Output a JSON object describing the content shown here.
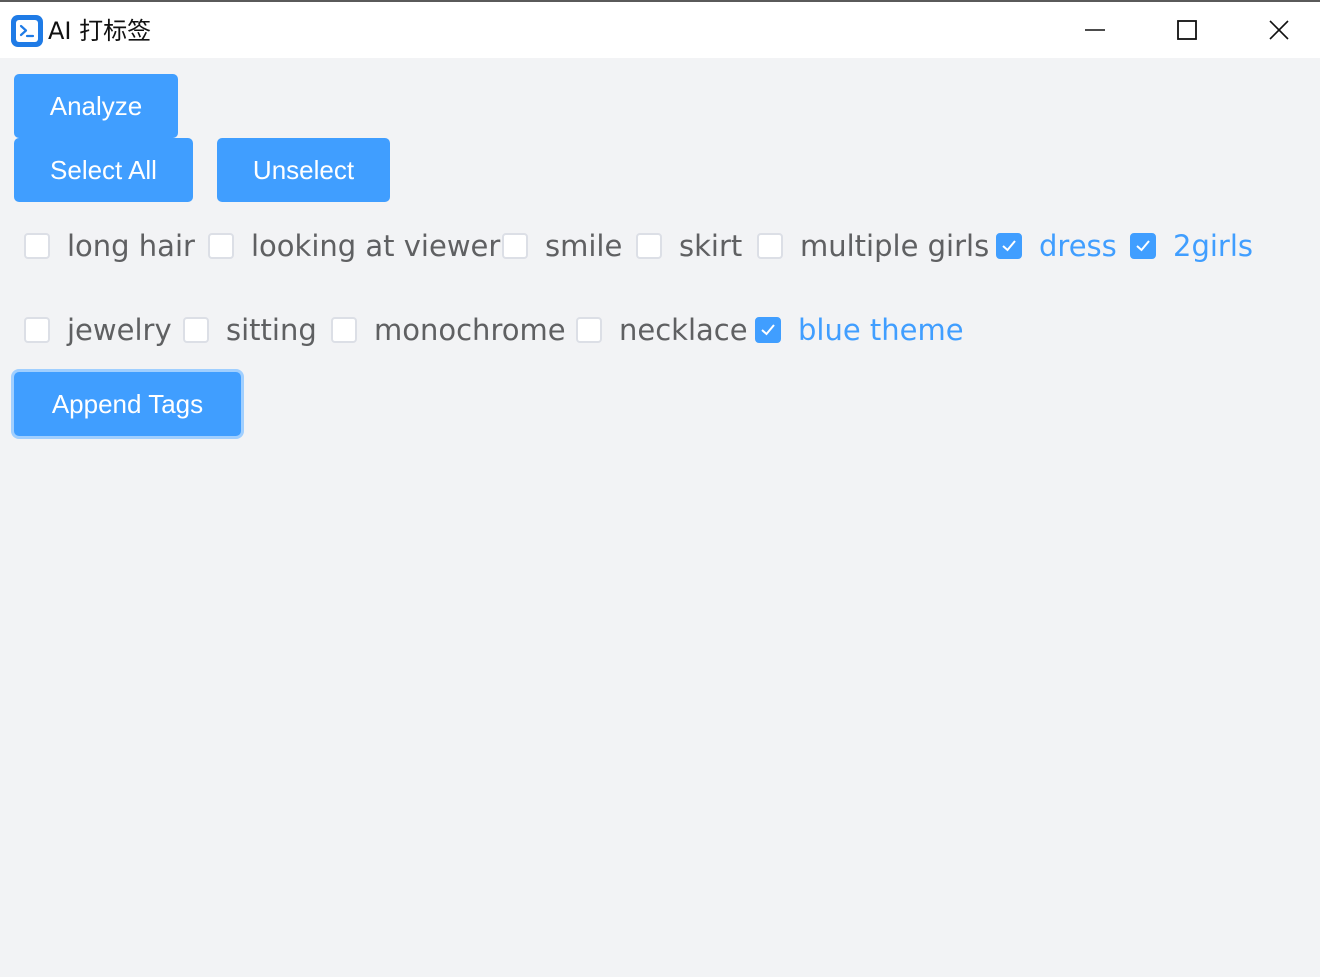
{
  "window": {
    "title": "AI 打标签",
    "icon": "terminal-app-icon",
    "controls": [
      "minimize-icon",
      "maximize-icon",
      "close-icon"
    ]
  },
  "buttons": {
    "analyze": "Analyze",
    "select_all": "Select All",
    "unselect": "Unselect",
    "append_tags": "Append Tags"
  },
  "colors": {
    "primary": "#409eff",
    "background": "#f2f3f5",
    "text": "#5f6062"
  },
  "tags": [
    {
      "label": "long hair",
      "checked": false
    },
    {
      "label": "looking at viewer",
      "checked": false
    },
    {
      "label": "smile",
      "checked": false
    },
    {
      "label": "skirt",
      "checked": false
    },
    {
      "label": "multiple girls",
      "checked": false
    },
    {
      "label": "dress",
      "checked": true
    },
    {
      "label": "2girls",
      "checked": true
    },
    {
      "label": "jewelry",
      "checked": false
    },
    {
      "label": "sitting",
      "checked": false
    },
    {
      "label": "monochrome",
      "checked": false
    },
    {
      "label": "necklace",
      "checked": false
    },
    {
      "label": "blue theme",
      "checked": true
    }
  ]
}
